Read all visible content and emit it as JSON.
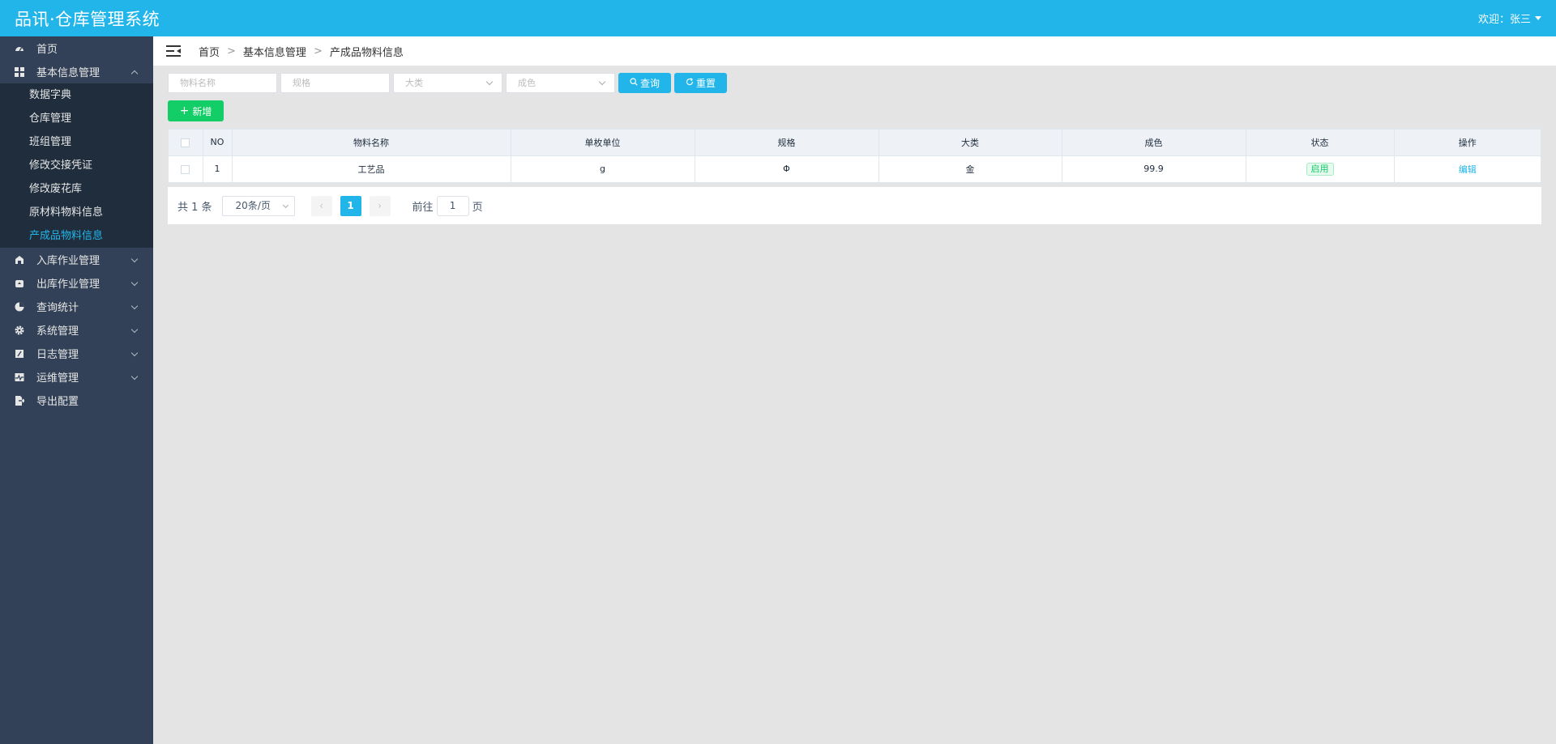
{
  "header": {
    "app_title": "品讯·仓库管理系统",
    "user_greeting": "欢迎：张三"
  },
  "sidebar": {
    "items": [
      {
        "label": "首页",
        "icon": "dashboard-icon"
      },
      {
        "label": "基本信息管理",
        "icon": "grid-icon",
        "expanded": true
      },
      {
        "label": "入库作业管理",
        "icon": "inbound-icon"
      },
      {
        "label": "出库作业管理",
        "icon": "outbound-icon"
      },
      {
        "label": "查询统计",
        "icon": "pie-chart-icon"
      },
      {
        "label": "系统管理",
        "icon": "gear-icon"
      },
      {
        "label": "日志管理",
        "icon": "log-icon"
      },
      {
        "label": "运维管理",
        "icon": "monitor-icon"
      },
      {
        "label": "导出配置",
        "icon": "export-icon"
      }
    ],
    "submenu": [
      {
        "label": "数据字典"
      },
      {
        "label": "仓库管理"
      },
      {
        "label": "班组管理"
      },
      {
        "label": "修改交接凭证"
      },
      {
        "label": "修改废花库"
      },
      {
        "label": "原材料物料信息"
      },
      {
        "label": "产成品物料信息",
        "active": true
      }
    ]
  },
  "breadcrumb": [
    "首页",
    "基本信息管理",
    "产成品物料信息"
  ],
  "breadcrumb_separator": ">",
  "filters": {
    "name_placeholder": "物料名称",
    "spec_placeholder": "规格",
    "category_placeholder": "大类",
    "purity_placeholder": "成色",
    "search_label": "查询",
    "reset_label": "重置"
  },
  "toolbar": {
    "add_label": "新增"
  },
  "table": {
    "columns": [
      "NO",
      "物料名称",
      "单枚单位",
      "规格",
      "大类",
      "成色",
      "状态",
      "操作"
    ],
    "rows": [
      {
        "no": "1",
        "name": "工艺品",
        "unit": "g",
        "spec": "Φ",
        "category": "金",
        "purity": "99.9",
        "status": "启用",
        "action": "编辑"
      }
    ]
  },
  "pagination": {
    "total_text": "共 1 条",
    "page_size": "20条/页",
    "current_page": "1",
    "goto_label": "前往",
    "goto_value": "1",
    "page_suffix": "页",
    "prev_symbol": "‹",
    "next_symbol": "›"
  },
  "colors": {
    "brand": "#21b5e9",
    "sidebar": "#324157",
    "submenu": "#1f2d3d",
    "success": "#13ce66"
  }
}
